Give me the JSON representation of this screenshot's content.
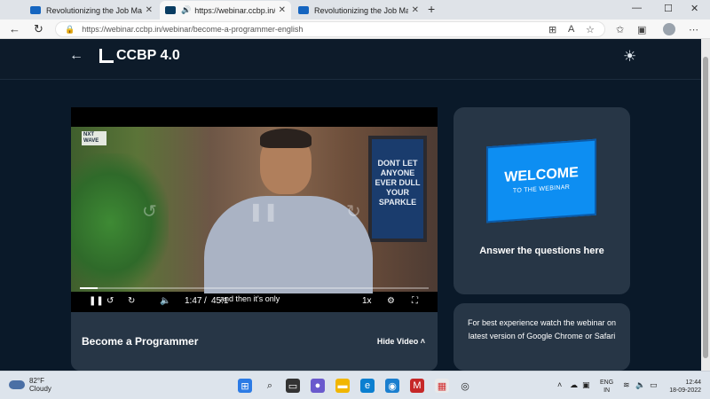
{
  "browser": {
    "tabs": [
      {
        "title": "Revolutionizing the Job Market |",
        "close": "✕"
      },
      {
        "title": "https://webinar.ccbp.in/web",
        "close": "✕"
      },
      {
        "title": "Revolutionizing the Job Market |",
        "close": "✕"
      }
    ],
    "new_tab": "+",
    "url": "https://webinar.ccbp.in/webinar/become-a-programmer-english",
    "window_controls": {
      "minimize": "—",
      "maximize": "☐",
      "close": "✕"
    }
  },
  "site": {
    "logo_text": "CCBP 4.0"
  },
  "video": {
    "watermark": "NXT\nWAVE",
    "poster_text": "DONT LET ANYONE EVER DULL YOUR SPARKLE",
    "caption": "and then it's only",
    "time_current": "1:47",
    "time_separator": "/",
    "time_total": "45:1",
    "speed": "1x",
    "progress": 0.05,
    "title": "Become a Programmer",
    "hide_label": "Hide Video"
  },
  "welcome": {
    "banner_big": "WELCOME",
    "banner_small": "TO THE WEBINAR",
    "answer_text": "Answer the questions here"
  },
  "tip": {
    "text": "For best experience watch the webinar on latest version of Google Chrome or Safari"
  },
  "taskbar": {
    "temperature": "82°F",
    "condition": "Cloudy",
    "lang_top": "ENG",
    "lang_bottom": "IN",
    "time": "12:44",
    "date": "18-09-2022"
  }
}
